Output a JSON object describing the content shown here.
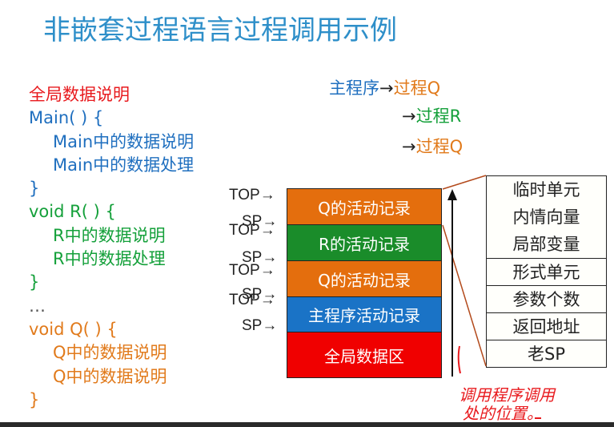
{
  "title": "非嵌套过程语言过程调用示例",
  "code": [
    {
      "text": "全局数据说明",
      "color": "red",
      "indent": 0
    },
    {
      "text": "Main( ) {",
      "color": "blue",
      "indent": 0
    },
    {
      "text": "Main中的数据说明",
      "color": "blue",
      "indent": 1
    },
    {
      "text": "Main中的数据处理",
      "color": "blue",
      "indent": 1
    },
    {
      "text": "}",
      "color": "blue",
      "indent": 0
    },
    {
      "text": "void R( ) {",
      "color": "green",
      "indent": 0
    },
    {
      "text": "R中的数据说明",
      "color": "green",
      "indent": 1
    },
    {
      "text": "R中的数据处理",
      "color": "green",
      "indent": 1
    },
    {
      "text": "}",
      "color": "green",
      "indent": 0
    },
    {
      "text": "…",
      "color": "gray",
      "indent": 0
    },
    {
      "text": "void Q( ) {",
      "color": "orange",
      "indent": 0
    },
    {
      "text": "Q中的数据说明",
      "color": "orange",
      "indent": 1
    },
    {
      "text": "Q中的数据说明",
      "color": "orange",
      "indent": 1
    },
    {
      "text": "}",
      "color": "orange",
      "indent": 0
    }
  ],
  "call_sequence": {
    "main": "主程序",
    "arrow": "→",
    "call1": "过程Q",
    "call2": "过程R",
    "call3": "过程Q"
  },
  "stack": {
    "records": [
      {
        "label": "Q的活动记录"
      },
      {
        "label": "R的活动记录"
      },
      {
        "label": "Q的活动记录"
      },
      {
        "label": "主程序活动记录"
      },
      {
        "label": "全局数据区"
      }
    ],
    "pointers": {
      "top": "TOP→",
      "sp": "SP→"
    }
  },
  "record_detail": {
    "cells": [
      "临时单元",
      "内情向量",
      "局部变量",
      "形式单元",
      "参数个数",
      "返回地址",
      "老SP"
    ]
  },
  "handwritten_note": {
    "line1": "调用程序调用",
    "line2": "处的位置。"
  },
  "colors": {
    "title": "#2e8fc9",
    "orange_record": "#e46e0d",
    "green_record": "#1a8c2a",
    "blue_record": "#1a73c6",
    "red_record": "#f00000",
    "annotation": "#e8191d",
    "connector": "#b34a1c"
  }
}
